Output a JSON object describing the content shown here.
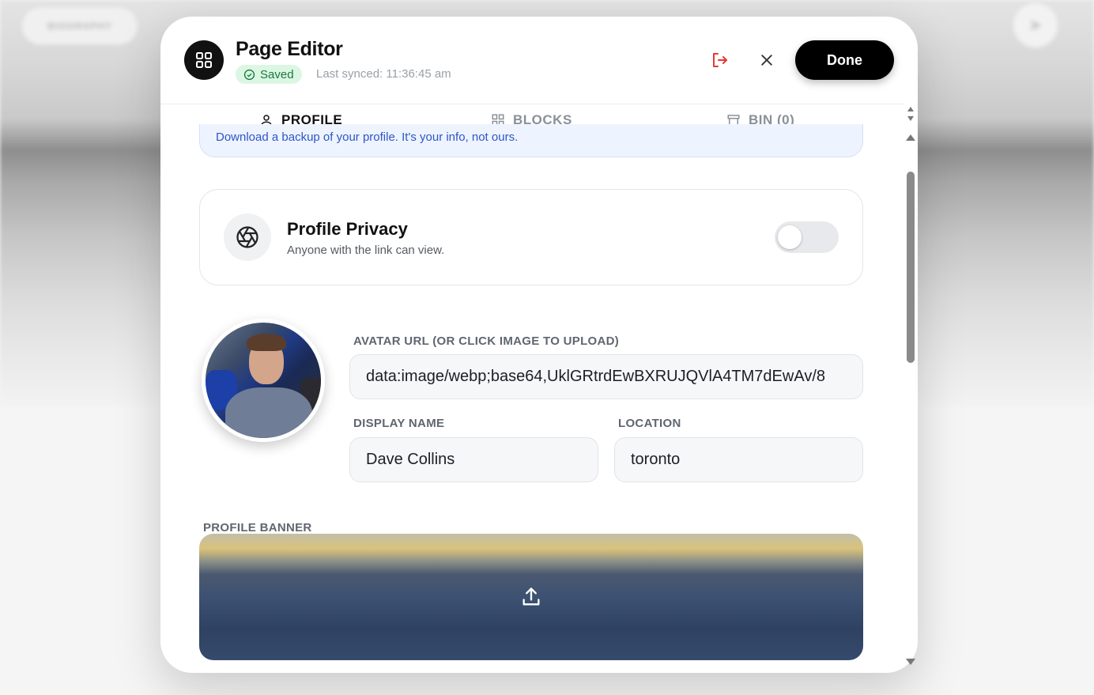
{
  "background": {
    "pill_label": "BIOGRAPHY"
  },
  "header": {
    "title": "Page Editor",
    "status_badge": "Saved",
    "last_synced": "Last synced: 11:36:45 am",
    "done_label": "Done"
  },
  "tabs": [
    {
      "label": "PROFILE",
      "active": true,
      "icon": "user-icon"
    },
    {
      "label": "BLOCKS",
      "active": false,
      "icon": "grid-icon"
    },
    {
      "label": "BIN (0)",
      "active": false,
      "icon": "archive-icon"
    }
  ],
  "export": {
    "description": "Download a backup of your profile. It's your info, not ours."
  },
  "privacy": {
    "title": "Profile Privacy",
    "subtitle": "Anyone with the link can view.",
    "toggle_on": false
  },
  "avatar": {
    "url_label": "AVATAR URL (OR CLICK IMAGE TO UPLOAD)",
    "url_value": "data:image/webp;base64,UklGRtrdEwBXRUJQVlA4TM7dEwAv/8"
  },
  "display_name": {
    "label": "DISPLAY NAME",
    "value": "Dave Collins"
  },
  "location": {
    "label": "LOCATION",
    "value": "toronto"
  },
  "banner": {
    "label": "PROFILE BANNER"
  },
  "colors": {
    "saved_bg": "#dcf6e4",
    "saved_text": "#177a3c",
    "logout_icon": "#e53935",
    "export_text": "#2e55c6"
  }
}
